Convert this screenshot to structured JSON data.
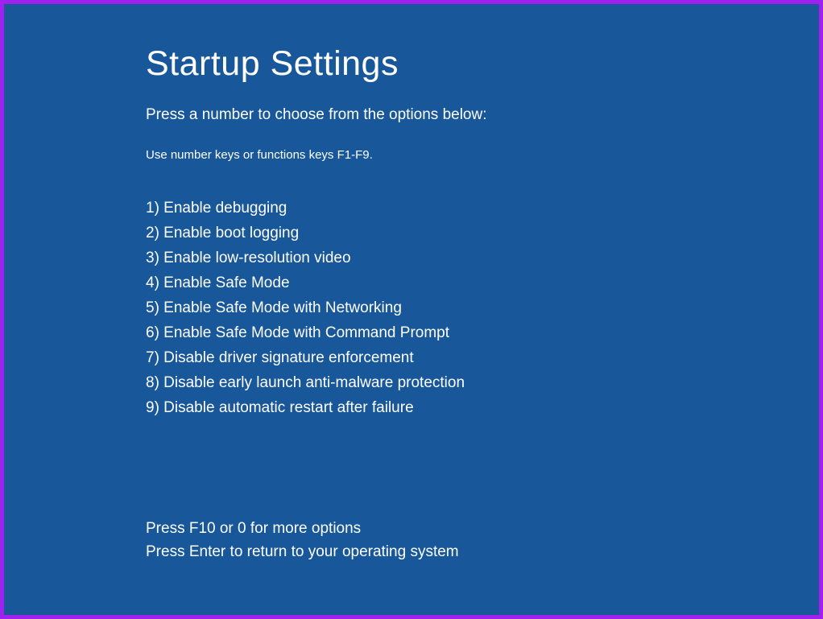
{
  "title": "Startup Settings",
  "subtitle": "Press a number to choose from the options below:",
  "hint": "Use number keys or functions keys F1-F9.",
  "options": [
    "1) Enable debugging",
    "2) Enable boot logging",
    "3) Enable low-resolution video",
    "4) Enable Safe Mode",
    "5) Enable Safe Mode with Networking",
    "6) Enable Safe Mode with Command Prompt",
    "7) Disable driver signature enforcement",
    "8) Disable early launch anti-malware protection",
    "9) Disable automatic restart after failure"
  ],
  "footer": {
    "more_options": "Press F10 or 0 for more options",
    "return": "Press Enter to return to your operating system"
  }
}
